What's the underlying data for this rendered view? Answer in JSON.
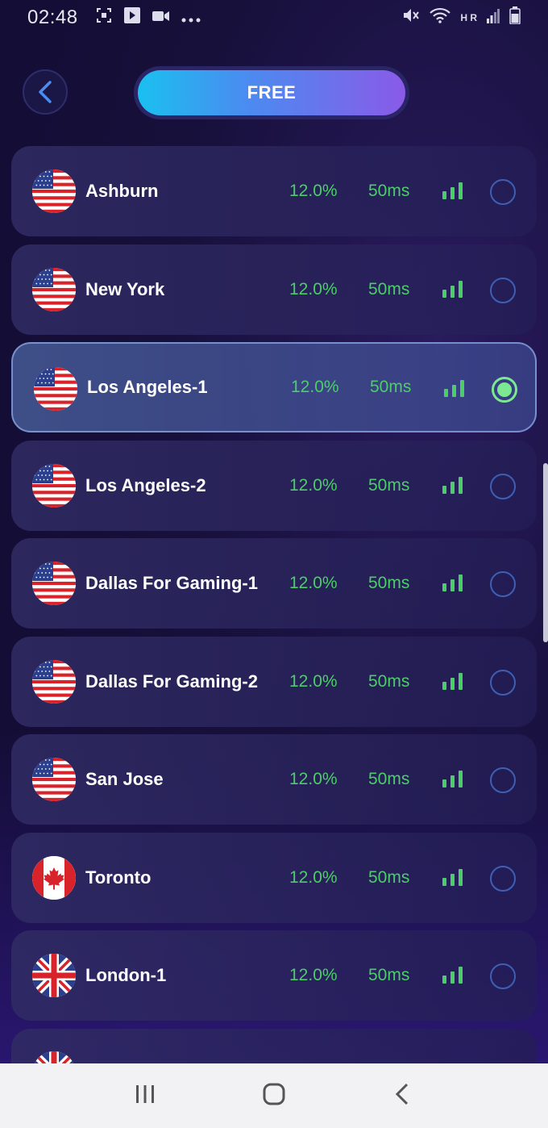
{
  "status_bar": {
    "time": "02:48",
    "network_label": "H R"
  },
  "header": {
    "title": "FREE"
  },
  "servers": [
    {
      "name": "Ashburn",
      "flag": "us",
      "load": "12.0%",
      "ping": "50ms",
      "selected": false
    },
    {
      "name": "New York",
      "flag": "us",
      "load": "12.0%",
      "ping": "50ms",
      "selected": false
    },
    {
      "name": "Los Angeles-1",
      "flag": "us",
      "load": "12.0%",
      "ping": "50ms",
      "selected": true
    },
    {
      "name": "Los Angeles-2",
      "flag": "us",
      "load": "12.0%",
      "ping": "50ms",
      "selected": false
    },
    {
      "name": "Dallas For Gaming-1",
      "flag": "us",
      "load": "12.0%",
      "ping": "50ms",
      "selected": false
    },
    {
      "name": "Dallas For Gaming-2",
      "flag": "us",
      "load": "12.0%",
      "ping": "50ms",
      "selected": false
    },
    {
      "name": "San Jose",
      "flag": "us",
      "load": "12.0%",
      "ping": "50ms",
      "selected": false
    },
    {
      "name": "Toronto",
      "flag": "ca",
      "load": "12.0%",
      "ping": "50ms",
      "selected": false
    },
    {
      "name": "London-1",
      "flag": "gb",
      "load": "12.0%",
      "ping": "50ms",
      "selected": false
    }
  ],
  "partial_row": {
    "flag": "gb"
  },
  "colors": {
    "accent_green": "#4ccd6a",
    "selected_radio": "#7ce892",
    "pill_start": "#1ac0f0",
    "pill_end": "#8a5ae8"
  },
  "icons": {
    "back": "chevron-left-icon",
    "signal": "signal-bars-icon",
    "nav_recent": "recent-apps-icon",
    "nav_home": "home-icon",
    "nav_back": "back-icon"
  }
}
